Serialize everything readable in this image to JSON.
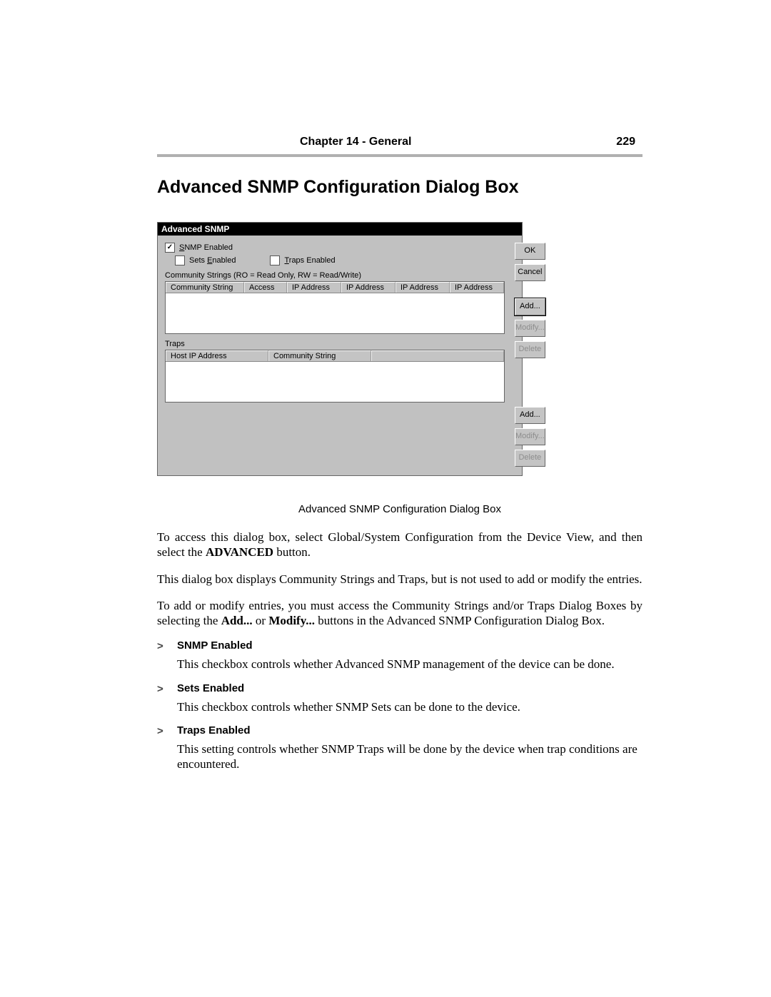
{
  "header": {
    "chapter": "Chapter 14 - General",
    "page_number": "229"
  },
  "title": "Advanced SNMP Configuration Dialog Box",
  "dialog": {
    "titlebar": "Advanced SNMP",
    "cb_snmp_label": "SNMP Enabled",
    "cb_snmp_underline": "S",
    "cb_snmp_checked": "✓",
    "cb_sets_label": "Sets Enabled",
    "cb_sets_underline": "E",
    "cb_traps_label": "Traps Enabled",
    "cb_traps_underline": "T",
    "community_caption_a": "Community Strings (RO = Read Only, RW = Read/Write)",
    "community_caption_u": "C",
    "cs_headers": {
      "community": "Community String",
      "access": "Access",
      "ip1": "IP Address",
      "ip2": "IP Address",
      "ip3": "IP Address",
      "ip4": "IP Address"
    },
    "traps_label": "Traps",
    "traps_underline": "T",
    "traps_headers": {
      "host": "Host IP Address",
      "community": "Community String"
    },
    "buttons": {
      "ok": "OK",
      "cancel": "Cancel",
      "add1": "Add...",
      "add1_u": "A",
      "modify1": "Modify...",
      "delete1": "Delete",
      "add2": "Add...",
      "modify2": "Modify...",
      "delete2": "Delete"
    }
  },
  "caption": "Advanced SNMP Configuration Dialog Box",
  "paragraphs": {
    "p1a": "To access this dialog box, select Global/System Configuration from the Device View, and then select the ",
    "p1b_bold": "ADVANCED",
    "p1c": " button.",
    "p2": "This dialog box displays Community Strings and Traps, but is not used to add or modify the entries.",
    "p3a": "To add or modify entries, you must access the Community Strings and/or Traps Dialog Boxes by selecting the ",
    "p3b_bold": "Add...",
    "p3c": " or ",
    "p3d_bold": "Modify...",
    "p3e": " buttons in the Advanced SNMP Configuration Dialog Box."
  },
  "items": {
    "snmp_h": "SNMP Enabled",
    "snmp_b": "This checkbox controls whether Advanced SNMP management of the device can be done.",
    "sets_h": "Sets Enabled",
    "sets_b": "This checkbox controls whether SNMP Sets can be done to the device.",
    "traps_h": "Traps Enabled",
    "traps_b": "This setting controls whether SNMP Traps will be done by the device when trap conditions are encountered."
  },
  "chevron": ">"
}
